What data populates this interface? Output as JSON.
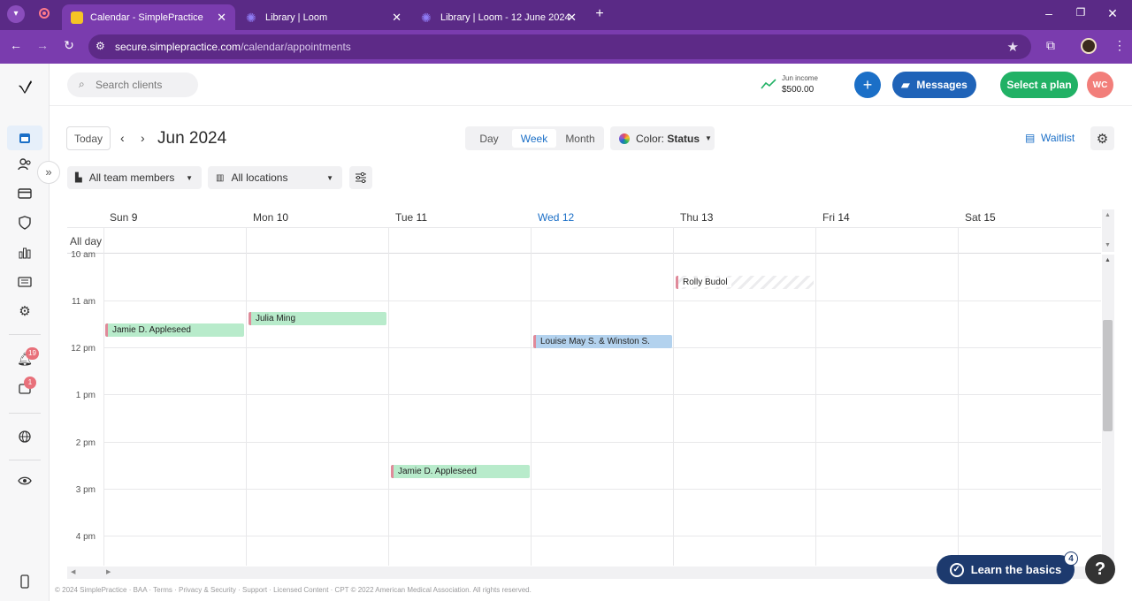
{
  "browser": {
    "tabs": [
      {
        "title": "Calendar - SimplePractice",
        "active": true,
        "favicon": "simplepractice-favicon"
      },
      {
        "title": "Library | Loom",
        "active": false,
        "favicon": "loom-favicon"
      },
      {
        "title": "Library | Loom - 12 June 2024",
        "active": false,
        "favicon": "loom-favicon"
      }
    ],
    "url_host": "secure.simplepractice.com",
    "url_path": "/calendar/appointments"
  },
  "header": {
    "search_placeholder": "Search clients",
    "income_label": "Jun income",
    "income_value": "$500.00",
    "messages_label": "Messages",
    "plan_label": "Select a plan",
    "avatar_initials": "WC"
  },
  "sidebar": {
    "notifications_count": "19",
    "inbox_count": "1"
  },
  "toolbar": {
    "today_label": "Today",
    "month_title": "Jun 2024",
    "views": [
      "Day",
      "Week",
      "Month"
    ],
    "active_view": "Week",
    "color_label": "Color:",
    "color_value": "Status",
    "waitlist_label": "Waitlist",
    "team_filter": "All team members",
    "location_filter": "All locations"
  },
  "calendar": {
    "all_day_label": "All day",
    "days": [
      {
        "name": "Sun",
        "num": "9"
      },
      {
        "name": "Mon",
        "num": "10"
      },
      {
        "name": "Tue",
        "num": "11"
      },
      {
        "name": "Wed",
        "num": "12",
        "today": true
      },
      {
        "name": "Thu",
        "num": "13"
      },
      {
        "name": "Fri",
        "num": "14"
      },
      {
        "name": "Sat",
        "num": "15"
      }
    ],
    "hours": [
      "10 am",
      "11 am",
      "12 pm",
      "1 pm",
      "2 pm",
      "3 pm",
      "4 pm"
    ],
    "appointments": [
      {
        "client": "Rolly Budol",
        "day": "Thu"
      },
      {
        "client": "Julia Ming",
        "day": "Mon"
      },
      {
        "client": "Jamie D. Appleseed",
        "day": "Sun"
      },
      {
        "client": "Louise May S. & Winston S.",
        "day": "Wed"
      },
      {
        "client": "Jamie D. Appleseed",
        "day": "Tue"
      }
    ]
  },
  "footer": {
    "text": "© 2024 SimplePractice · BAA · Terms · Privacy & Security · Support · Licensed Content · CPT © 2022 American Medical Association. All rights reserved."
  },
  "help": {
    "learn_label": "Learn the basics",
    "learn_count": "4",
    "help_glyph": "?"
  },
  "colors": {
    "brand_blue": "#1b6fc7",
    "messages_blue": "#1f63b8",
    "plan_green": "#21b165",
    "appt_green": "#b8ebcb",
    "appt_blue": "#b3d2ee",
    "browser_purple": "#7a3cae"
  }
}
